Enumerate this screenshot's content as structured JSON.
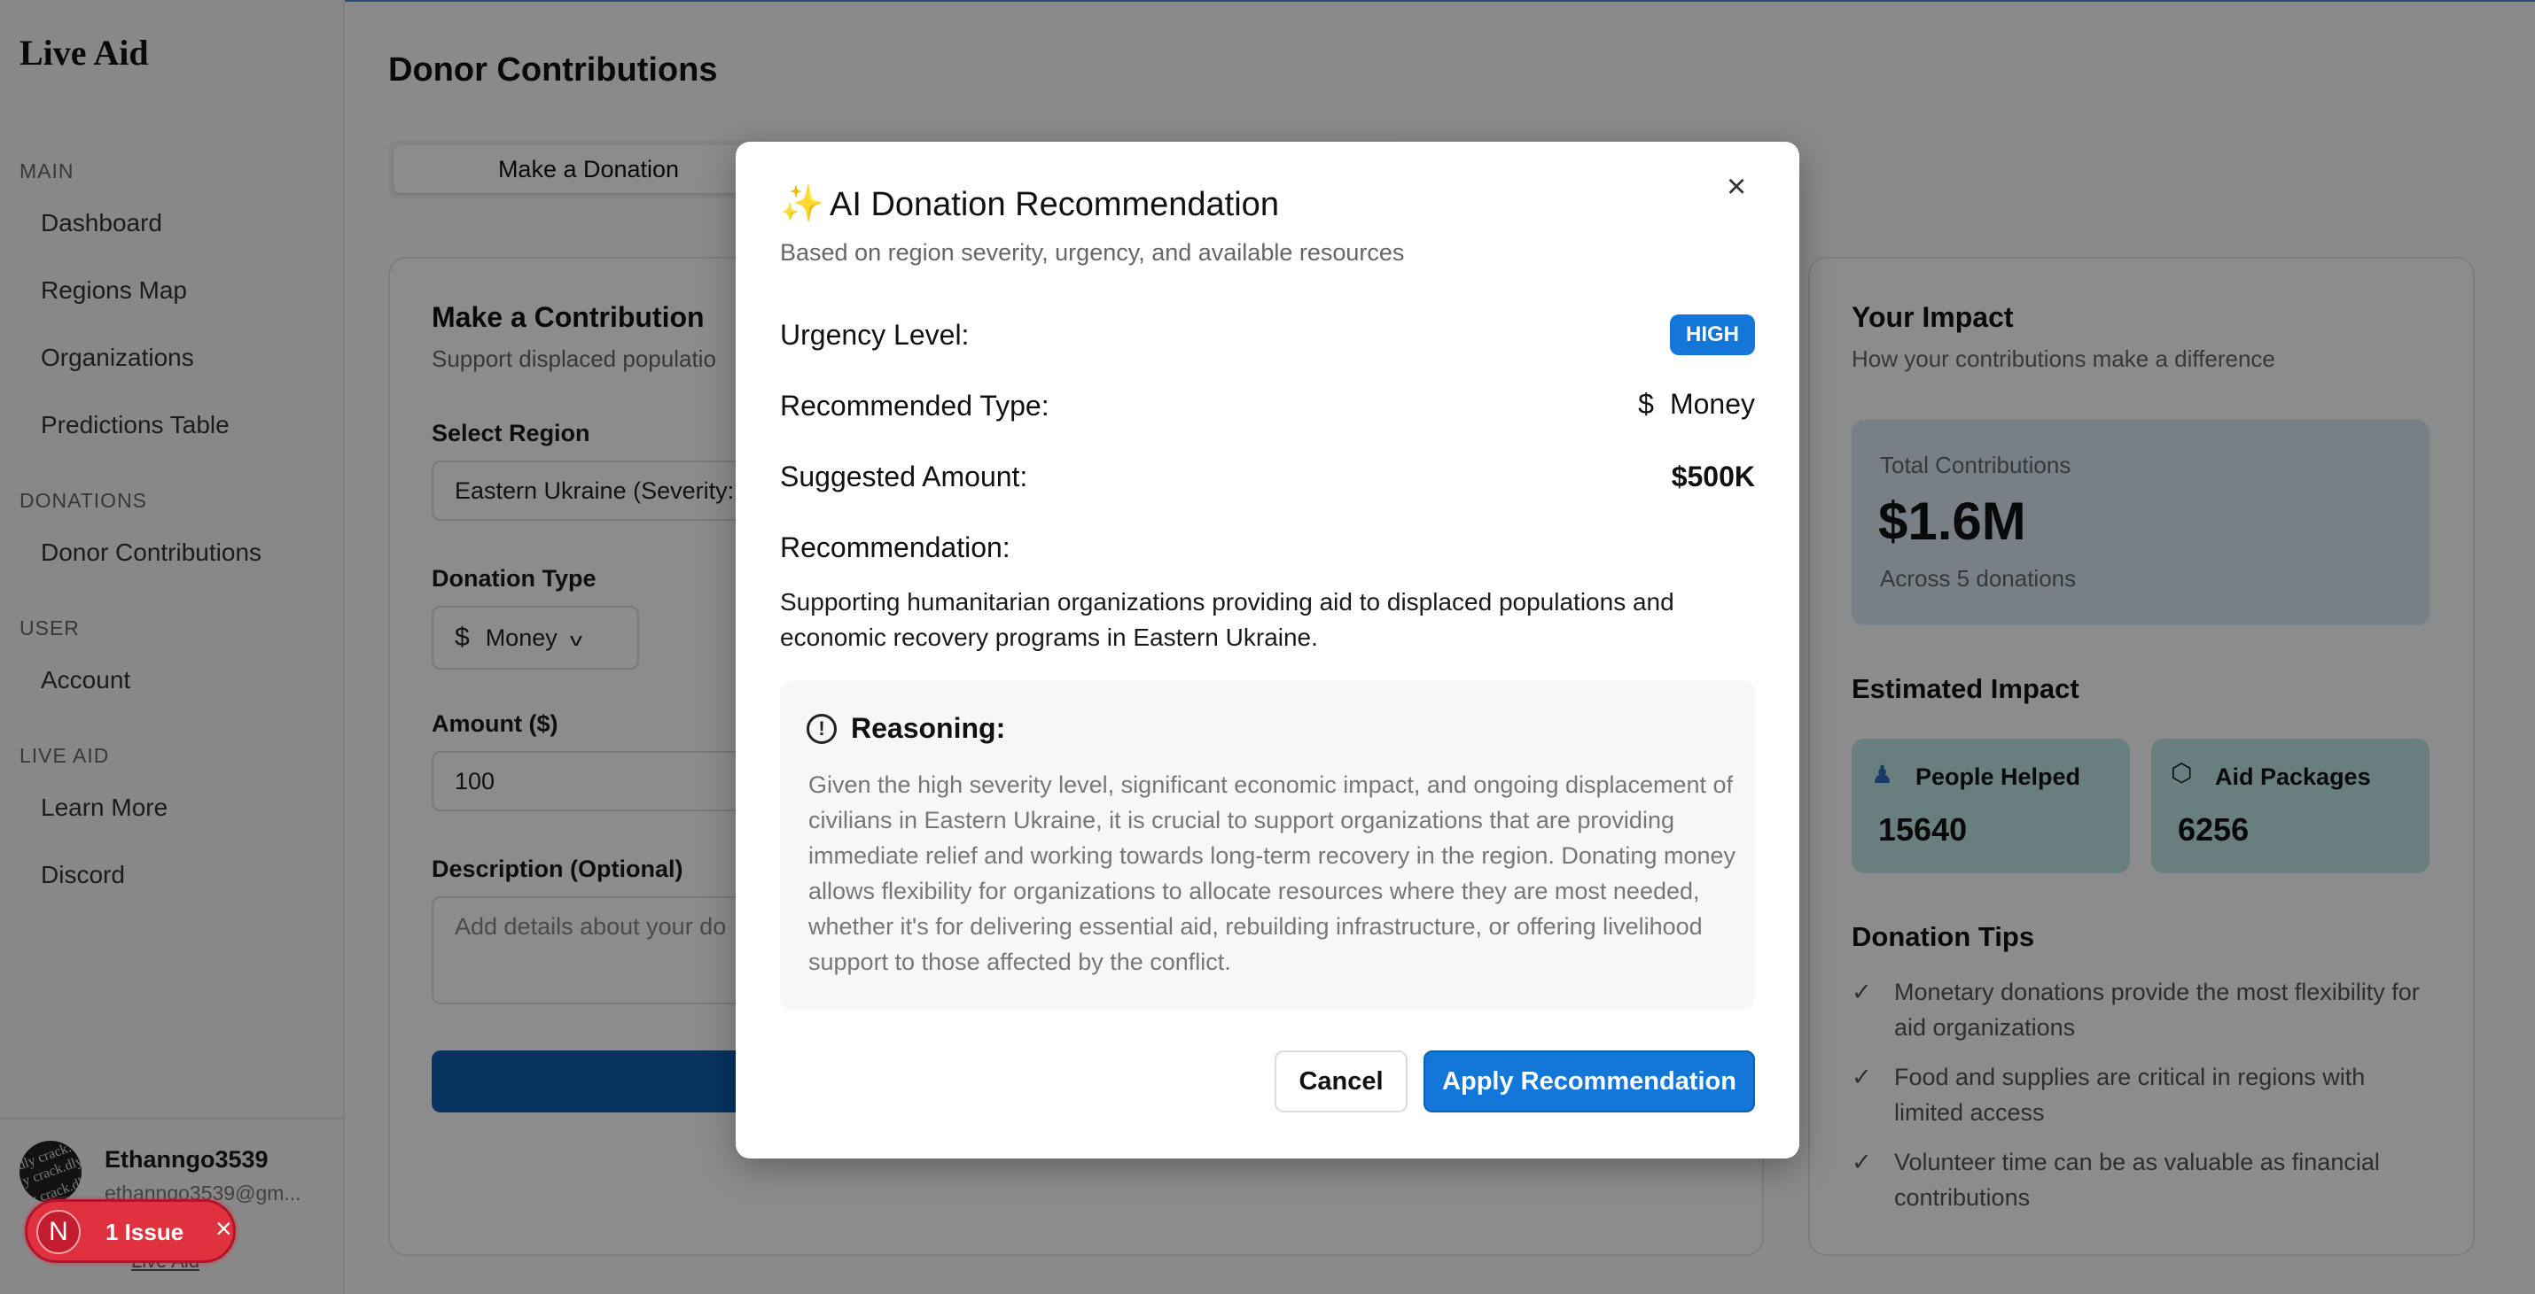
{
  "app": {
    "brand": "Live Aid"
  },
  "sidebar": {
    "sections": [
      {
        "title": "MAIN",
        "items": [
          "Dashboard",
          "Regions Map",
          "Organizations",
          "Predictions Table"
        ]
      },
      {
        "title": "DONATIONS",
        "items": [
          "Donor Contributions"
        ]
      },
      {
        "title": "USER",
        "items": [
          "Account"
        ]
      },
      {
        "title": "LIVE AID",
        "items": [
          "Learn More",
          "Discord"
        ]
      }
    ],
    "user": {
      "name": "Ethanngo3539",
      "email": "ethanngo3539@gm...",
      "avatar_text": "dly crack.dly"
    },
    "footer_link": "Live Aid",
    "issue_badge": {
      "letter": "N",
      "label": "1 Issue"
    }
  },
  "main": {
    "title": "Donor Contributions",
    "tab_active": "Make a Donation",
    "form": {
      "title": "Make a Contribution",
      "subtitle": "Support displaced populatio",
      "region_label": "Select Region",
      "region_value": "Eastern Ukraine (Severity:",
      "type_label": "Donation Type",
      "type_value": "Money",
      "amount_label": "Amount ($)",
      "amount_value": "100",
      "desc_label": "Description (Optional)",
      "desc_placeholder": "Add details about your do"
    },
    "impact": {
      "title": "Your Impact",
      "subtitle": "How your contributions make a difference",
      "total_label": "Total Contributions",
      "total_value": "$1.6M",
      "total_sub": "Across 5 donations",
      "estimated_title": "Estimated Impact",
      "people_label": "People Helped",
      "people_value": "15640",
      "packages_label": "Aid Packages",
      "packages_value": "6256",
      "tips_title": "Donation Tips",
      "tips": [
        "Monetary donations provide the most flexibility for aid organizations",
        "Food and supplies are critical in regions with limited access",
        "Volunteer time can be as valuable as financial contributions"
      ]
    }
  },
  "modal": {
    "title": "AI Donation Recommendation",
    "subtitle": "Based on region severity, urgency, and available resources",
    "urgency_label": "Urgency Level:",
    "urgency_value": "HIGH",
    "type_label": "Recommended Type:",
    "type_value": "Money",
    "amount_label": "Suggested Amount:",
    "amount_value": "$500K",
    "rec_label": "Recommendation:",
    "rec_text": "Supporting humanitarian organizations providing aid to displaced populations and economic recovery programs in Eastern Ukraine.",
    "reasoning_label": "Reasoning:",
    "reasoning_text": "Given the high severity level, significant economic impact, and ongoing displacement of civilians in Eastern Ukraine, it is crucial to support organizations that are providing immediate relief and working towards long-term recovery in the region. Donating money allows flexibility for organizations to allocate resources where they are most needed, whether it's for delivering essential aid, rebuilding infrastructure, or offering livelihood support to those affected by the conflict.",
    "cancel_label": "Cancel",
    "apply_label": "Apply Recommendation"
  },
  "colors": {
    "accent": "#1277d8",
    "badge_red": "#e0313f",
    "impact_teal": "#bfe8e8",
    "total_blue": "#dce7f6"
  }
}
